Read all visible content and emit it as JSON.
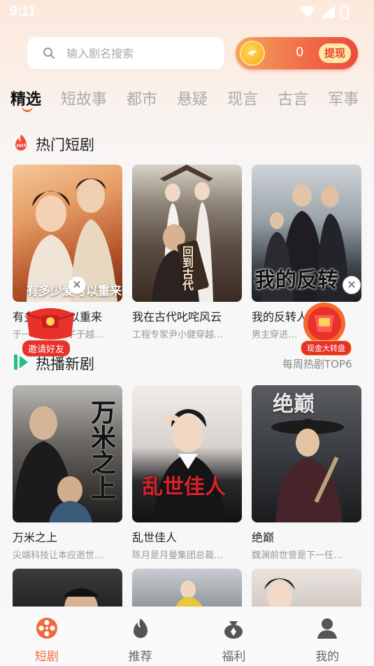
{
  "status_bar": {
    "time": "9:11"
  },
  "search": {
    "placeholder": "输入剧名搜索"
  },
  "coins": {
    "count": "0",
    "withdraw_label": "提现"
  },
  "tabs": [
    {
      "label": "精选"
    },
    {
      "label": "短故事"
    },
    {
      "label": "都市"
    },
    {
      "label": "悬疑"
    },
    {
      "label": "现言"
    },
    {
      "label": "古言"
    },
    {
      "label": "军事"
    }
  ],
  "hot_section": {
    "title": "热门短剧",
    "badge": "HOT",
    "cards": [
      {
        "title": "有多少爱可以重来",
        "desc": "于一个痴情女子于越…",
        "poster_text": "有多少爱可以重来"
      },
      {
        "title": "我在古代叱咤风云",
        "desc": "工程专家尹小健穿越…",
        "poster_text": "回到古代"
      },
      {
        "title": "我的反转人生",
        "desc": "男主穿进…",
        "poster_text": "我的反转"
      }
    ]
  },
  "new_section": {
    "title": "热播新剧",
    "link": "每周热剧TOP6",
    "cards": [
      {
        "title": "万米之上",
        "desc": "尖端科技让本应逝世…",
        "poster_text": "万米之上"
      },
      {
        "title": "乱世佳人",
        "desc": "陈月是月曼集团总裁…",
        "poster_text": "乱世佳人"
      },
      {
        "title": "绝巅",
        "desc": "魏渊前世曾是下一任…",
        "poster_text": "绝巅"
      }
    ]
  },
  "promos": {
    "invite_label": "邀请好友",
    "wheel_label": "现金大转盘"
  },
  "bottom_nav": [
    {
      "label": "短剧"
    },
    {
      "label": "推荐"
    },
    {
      "label": "福利"
    },
    {
      "label": "我的"
    }
  ],
  "colors": {
    "accent": "#f06a3f",
    "coin_pill": "#ec4b3c",
    "hot_red": "#e8312a",
    "new_green": "#1fc08a"
  }
}
